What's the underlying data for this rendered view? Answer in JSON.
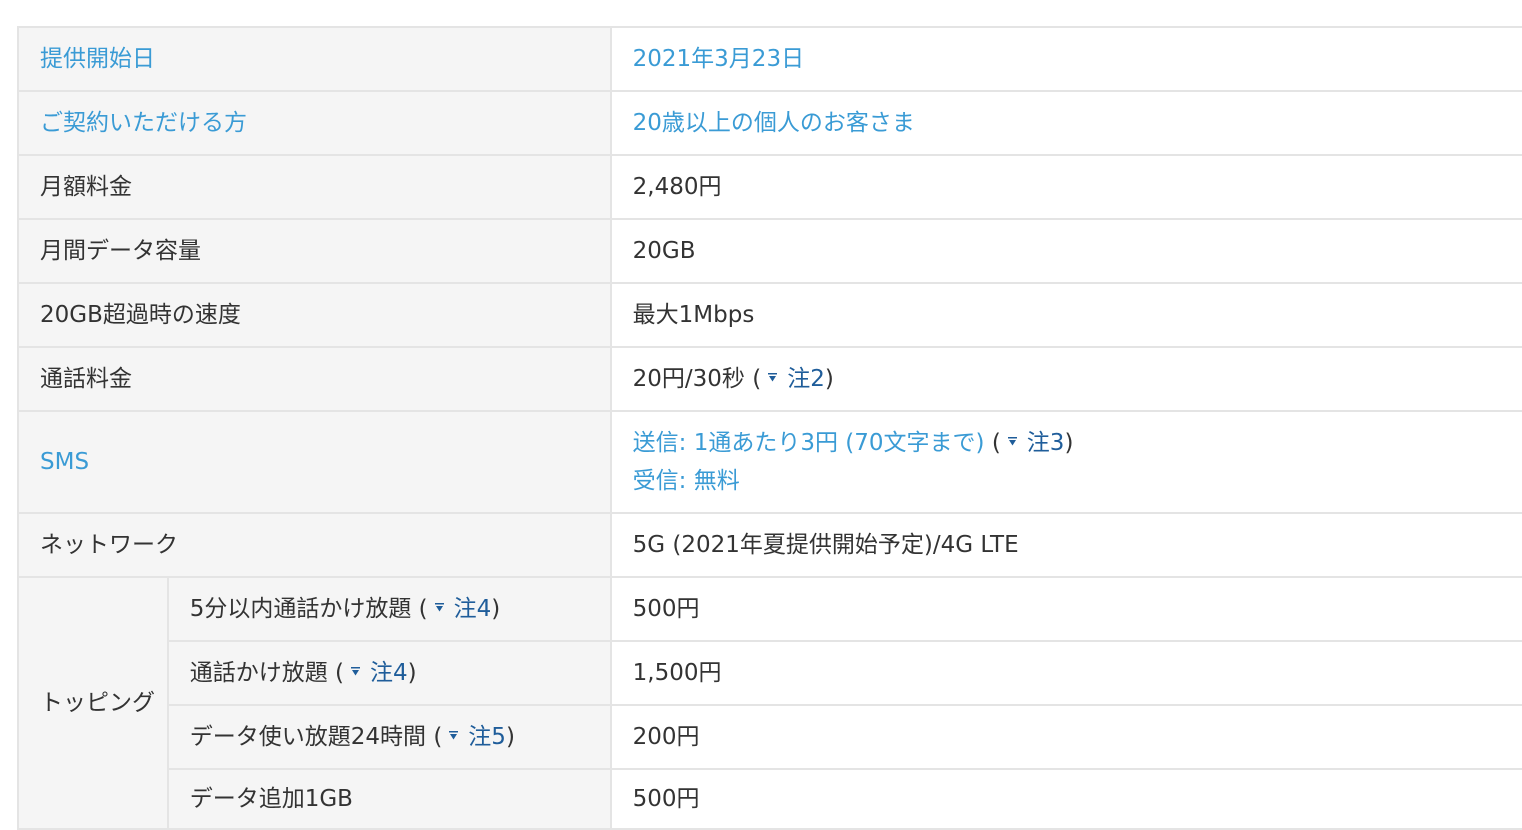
{
  "rows": [
    {
      "label": "提供開始日",
      "value": "2021年3月23日"
    },
    {
      "label": "ご契約いただける方",
      "value": "20歳以上の個人のお客さま"
    },
    {
      "label": "月額料金",
      "value": "2,480円"
    },
    {
      "label": "月間データ容量",
      "value": "20GB"
    },
    {
      "label": "20GB超過時の速度",
      "value": "最大1Mbps"
    },
    {
      "label": "通話料金",
      "value": "20円/30秒",
      "note": "注2"
    },
    {
      "label": "SMS",
      "value_line1": "送信: 1通あたり3円 (70文字まで)",
      "note": "注3",
      "value_line2": "受信: 無料"
    },
    {
      "label": "ネットワーク",
      "value": "5G (2021年夏提供開始予定)/4G LTE"
    }
  ],
  "topping": {
    "group_label": "トッピング",
    "items": [
      {
        "label": "5分以内通話かけ放題",
        "note": "注4",
        "value": "500円"
      },
      {
        "label": "通話かけ放題",
        "note": "注4",
        "value": "1,500円"
      },
      {
        "label": "データ使い放題24時間",
        "note": "注5",
        "value": "200円"
      },
      {
        "label": "データ追加1GB",
        "value": "500円"
      }
    ]
  },
  "punctuation": {
    "open": "(",
    "close": ")"
  },
  "icon": {
    "name": "down-arrow-icon"
  },
  "colors": {
    "link_blue": "#3a9bd5",
    "note_blue": "#1f5d9a",
    "label_bg": "#f5f5f5",
    "border": "#e4e4e4",
    "text": "#333333"
  }
}
